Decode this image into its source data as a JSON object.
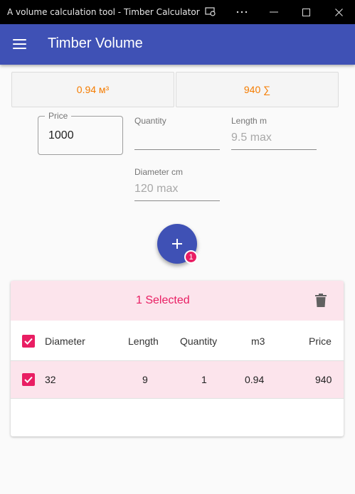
{
  "window": {
    "title": "A volume calculation tool - Timber Calculator"
  },
  "appbar": {
    "title": "Timber Volume"
  },
  "summary": {
    "volume": "0.94 м³",
    "total": "940 ∑"
  },
  "form": {
    "price": {
      "label": "Price",
      "value": "1000"
    },
    "quantity": {
      "label": "Quantity",
      "placeholder": ""
    },
    "length": {
      "label": "Length m",
      "placeholder": "9.5 max"
    },
    "diameter": {
      "label": "Diameter cm",
      "placeholder": "120 max"
    }
  },
  "fab": {
    "icon": "plus-icon",
    "badge": "1"
  },
  "table": {
    "selected_text": "1 Selected",
    "columns": [
      "Diameter",
      "Length",
      "Quantity",
      "m3",
      "Price"
    ],
    "rows": [
      {
        "selected": true,
        "cells": [
          "32",
          "9",
          "1",
          "0.94",
          "940"
        ]
      }
    ]
  },
  "colors": {
    "primary": "#3f51b5",
    "accent": "#e91e63",
    "summary_text": "#f57c00",
    "selected_bg": "#fce4ec"
  }
}
